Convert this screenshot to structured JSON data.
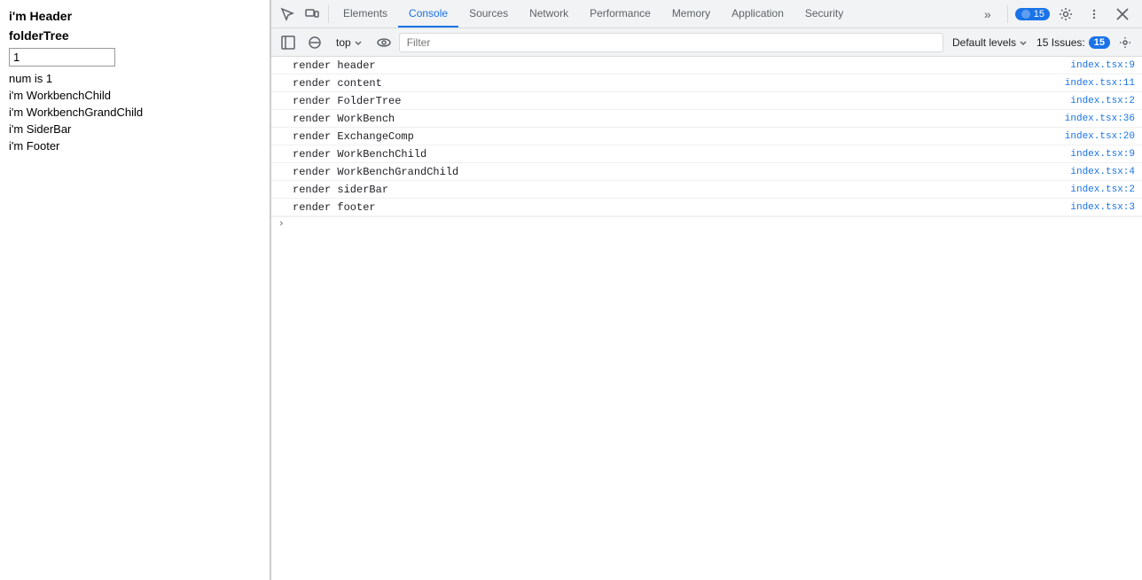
{
  "webpage": {
    "header": "i'm Header",
    "folderTree": "folderTree",
    "inputValue": "1",
    "numText": "num is 1",
    "workbenchChild": "i'm WorkbenchChild",
    "workbenchGrandChild": "i'm WorkbenchGrandChild",
    "siderBar": "i'm SiderBar",
    "footer": "i'm Footer"
  },
  "devtools": {
    "tabs": [
      {
        "label": "Elements",
        "active": false
      },
      {
        "label": "Console",
        "active": true
      },
      {
        "label": "Sources",
        "active": false
      },
      {
        "label": "Network",
        "active": false
      },
      {
        "label": "Performance",
        "active": false
      },
      {
        "label": "Memory",
        "active": false
      },
      {
        "label": "Application",
        "active": false
      },
      {
        "label": "Security",
        "active": false
      }
    ],
    "moreTabsLabel": "»",
    "issuesBadgeCount": "15",
    "toolbar": {
      "contextLabel": "top",
      "filterPlaceholder": "Filter",
      "defaultLevelsLabel": "Default levels",
      "issuesLabel": "15 Issues:",
      "issuesCount": "15"
    },
    "console": {
      "rows": [
        {
          "message": "render header",
          "source": "index.tsx:9"
        },
        {
          "message": "render content",
          "source": "index.tsx:11"
        },
        {
          "message": "render FolderTree",
          "source": "index.tsx:2"
        },
        {
          "message": "render WorkBench",
          "source": "index.tsx:36"
        },
        {
          "message": "render ExchangeComp",
          "source": "index.tsx:20"
        },
        {
          "message": "render WorkBenchChild",
          "source": "index.tsx:9"
        },
        {
          "message": "render WorkBenchGrandChild",
          "source": "index.tsx:4"
        },
        {
          "message": "render siderBar",
          "source": "index.tsx:2"
        },
        {
          "message": "render footer",
          "source": "index.tsx:3"
        }
      ]
    }
  }
}
